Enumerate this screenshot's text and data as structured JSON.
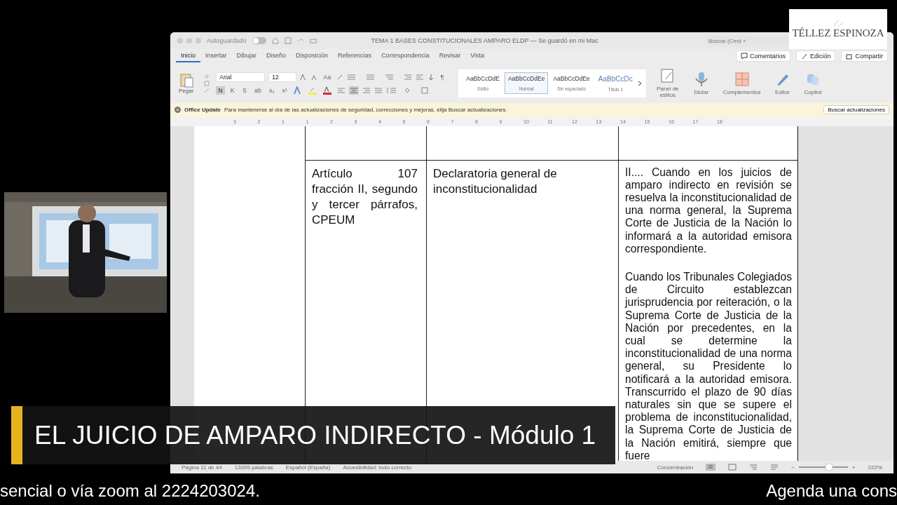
{
  "logo": {
    "name": "TÉLLEZ ESPINOZA"
  },
  "window": {
    "autosave_label": "Autoguardado",
    "autosave_on": false,
    "title": "TEMA 1 BASES CONSTITUCIONALES AMPARO  ELDP — Se guardó en mi Mac",
    "search": {
      "placeholder": "Buscar (Cmd +"
    }
  },
  "tabs": [
    {
      "label": "Inicio",
      "selected": true
    },
    {
      "label": "Insertar",
      "selected": false
    },
    {
      "label": "Dibujar",
      "selected": false
    },
    {
      "label": "Diseño",
      "selected": false
    },
    {
      "label": "Disposición",
      "selected": false
    },
    {
      "label": "Referencias",
      "selected": false
    },
    {
      "label": "Correspondencia",
      "selected": false
    },
    {
      "label": "Revisar",
      "selected": false
    },
    {
      "label": "Vista",
      "selected": false
    }
  ],
  "header_buttons": [
    "Comentarios",
    "Edición",
    "Compartir"
  ],
  "ribbon": {
    "paste": "Pegar",
    "font": "Arial",
    "size": "12",
    "case_button": "Aa",
    "format_buttons": [
      {
        "label": "N",
        "selected": true
      },
      {
        "label": "K",
        "selected": false
      },
      {
        "label": "S",
        "selected": false
      },
      {
        "label": "ab",
        "selected": false
      },
      {
        "label": "x₁",
        "selected": false
      },
      {
        "label": "x¹",
        "selected": false
      }
    ],
    "pilcrow": "¶",
    "styles": [
      {
        "sample": "AaBbCcDdE",
        "name": "Estilo",
        "selected": false
      },
      {
        "sample": "AaBbCcDdEe",
        "name": "Normal",
        "selected": true
      },
      {
        "sample": "AaBbCcDdEe",
        "name": "Sin espaciado",
        "selected": false
      },
      {
        "sample": "AaBbCcDc",
        "name": "Título 1",
        "selected": false
      }
    ],
    "tools": [
      "Panel de estilos",
      "Dictar",
      "Complementos",
      "Editor",
      "Copilot"
    ]
  },
  "info_bar": {
    "title": "Office Update",
    "message": "Para mantenerse al día de las actualizaciones de seguridad, correcciones y mejoras, elija Buscar actualizaciones.",
    "button": "Buscar actualizaciones"
  },
  "ruler": [
    "3",
    "2",
    "1",
    "1",
    "2",
    "3",
    "4",
    "5",
    "6",
    "7",
    "8",
    "9",
    "10",
    "11",
    "12",
    "13",
    "14",
    "15",
    "16",
    "17",
    "18"
  ],
  "table": {
    "rows": [
      [
        "",
        "",
        [
          ""
        ]
      ],
      [
        "Artículo 107 fracción II, segundo y tercer párrafos, CPEUM",
        "Declaratoria general de inconstitucionalidad",
        [
          "II.... Cuando en los juicios de amparo indirecto en revisión se resuelva la inconstitucionalidad de una norma general, la Suprema Corte de Justicia de la Nación lo informará a la autoridad emisora correspondiente.",
          "Cuando los Tribunales Colegiados de Circuito establezcan jurisprudencia por reiteración, o la Suprema Corte de Justicia de la Nación por precedentes, en la cual se determine la inconstitucionalidad de una norma general, su Presidente lo notificará a la autoridad emisora. Transcurrido el plazo de 90 días naturales sin que se supere el problema de inconstitucionalidad, la Suprema Corte de Justicia de la Nación emitirá, siempre que fuere"
        ]
      ]
    ]
  },
  "status_bar": {
    "page": "Página 11 de 44",
    "words": "13395 palabras",
    "language": "Español (España)",
    "accessibility": "Accesibilidad: todo correcto",
    "focus": "Concentración",
    "zoom_out": "−",
    "zoom_slider": {
      "level": 0.62
    },
    "zoom_in": "+",
    "zoom": "222%"
  },
  "webcam": {
    "kind": "picture"
  },
  "banner": {
    "title": "EL JUICIO DE AMPARO INDIRECTO - Módulo 1"
  },
  "ticker": [
    "sencial o vía zoom al 2224203024.",
    "Agenda una cons"
  ]
}
